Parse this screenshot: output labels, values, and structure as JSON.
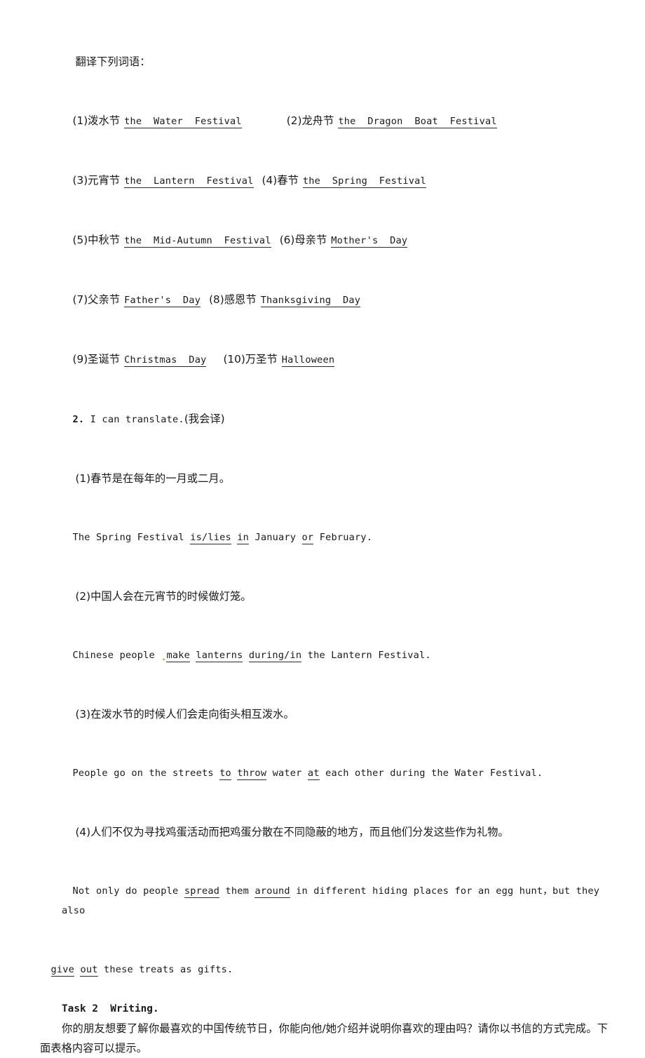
{
  "document": {
    "heading": "翻译下列词语：",
    "vocab_items": [
      {
        "num": "(1)",
        "cn": "泼水节",
        "answer": "the  Water  Festival"
      },
      {
        "num": "(2)",
        "cn": "龙舟节",
        "answer": "the  Dragon  Boat  Festival"
      },
      {
        "num": "(3)",
        "cn": "元宵节",
        "answer": "the  Lantern  Festival"
      },
      {
        "num": "(4)",
        "cn": "春节",
        "answer": "the  Spring  Festival"
      },
      {
        "num": "(5)",
        "cn": "中秋节",
        "answer": "the  Mid-Autumn  Festival"
      },
      {
        "num": "(6)",
        "cn": "母亲节",
        "answer": "Mother's  Day"
      },
      {
        "num": "(7)",
        "cn": "父亲节",
        "answer": "Father's  Day"
      },
      {
        "num": "(8)",
        "cn": "感恩节",
        "answer": "Thanksgiving  Day"
      },
      {
        "num": "(9)",
        "cn": "圣诞节",
        "answer": "Christmas  Day"
      },
      {
        "num": "(10)",
        "cn": "万圣节",
        "answer": "Halloween"
      }
    ],
    "section2": {
      "number": "2.",
      "title_en": " I can translate.",
      "title_cn": "(我会译)",
      "items": [
        {
          "num": "(1)",
          "prompt_cn": "春节是在每年的一月或二月。",
          "answer_parts": [
            {
              "t": "The Spring Festival ",
              "u": false
            },
            {
              "t": "is/lies",
              "u": true
            },
            {
              "t": " ",
              "u": false
            },
            {
              "t": "in",
              "u": true
            },
            {
              "t": " January ",
              "u": false
            },
            {
              "t": "or",
              "u": true
            },
            {
              "t": " February.",
              "u": false
            }
          ]
        },
        {
          "num": "(2)",
          "prompt_cn": "中国人会在元宵节的时候做灯笼。",
          "answer_parts": [
            {
              "t": "Chinese people ",
              "u": false
            },
            {
              "t": "make",
              "u": true,
              "mark": true
            },
            {
              "t": " ",
              "u": false
            },
            {
              "t": "lanterns",
              "u": true
            },
            {
              "t": " ",
              "u": false
            },
            {
              "t": "during/in",
              "u": true
            },
            {
              "t": " the Lantern Festival.",
              "u": false
            }
          ]
        },
        {
          "num": "(3)",
          "prompt_cn": "在泼水节的时候人们会走向街头相互泼水。",
          "answer_parts": [
            {
              "t": "People go on the streets ",
              "u": false
            },
            {
              "t": "to",
              "u": true
            },
            {
              "t": " ",
              "u": false
            },
            {
              "t": "throw",
              "u": true
            },
            {
              "t": " water ",
              "u": false
            },
            {
              "t": "at",
              "u": true
            },
            {
              "t": " each other during the Water Festival.",
              "u": false
            }
          ]
        },
        {
          "num": "(4)",
          "prompt_cn": "人们不仅为寻找鸡蛋活动而把鸡蛋分散在不同隐蔽的地方，而且他们分发这些作为礼物。",
          "answer_parts": [
            {
              "t": "Not only do people ",
              "u": false
            },
            {
              "t": "spread",
              "u": true
            },
            {
              "t": " them ",
              "u": false
            },
            {
              "t": "around",
              "u": true
            },
            {
              "t": " in different hiding places for an egg hunt，but they also ",
              "u": false
            }
          ],
          "answer_parts_wrapped": [
            {
              "t": "give",
              "u": true
            },
            {
              "t": " ",
              "u": false
            },
            {
              "t": "out",
              "u": true
            },
            {
              "t": " these treats as gifts.",
              "u": false
            }
          ]
        }
      ]
    },
    "task2": {
      "heading": "Task 2  Writing.",
      "body": "你的朋友想要了解你最喜欢的中国传统节日，你能向他/她介绍并说明你喜欢的理由吗？请你以书信的方式完成。下面表格内容可以提示。"
    }
  }
}
